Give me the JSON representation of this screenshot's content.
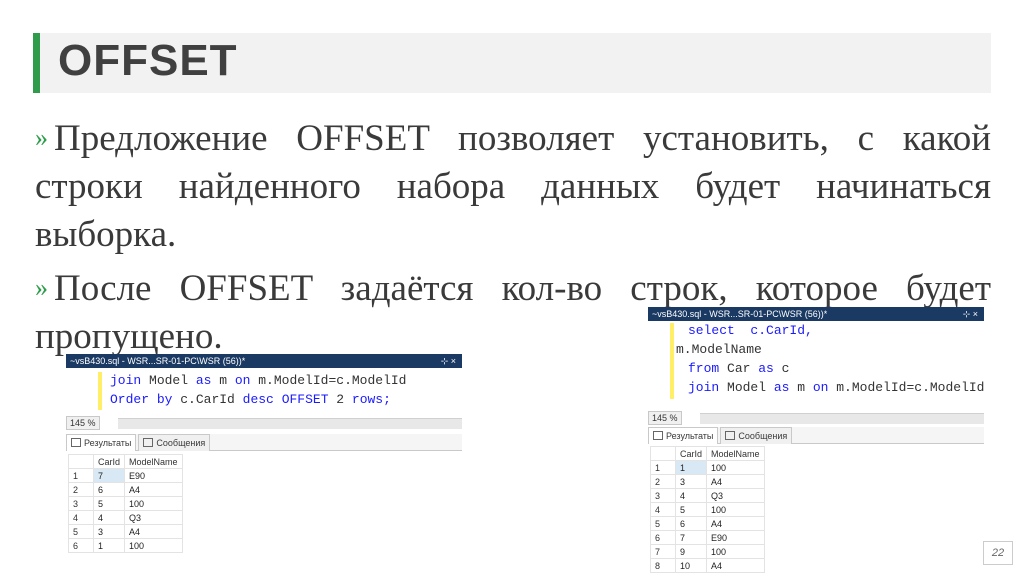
{
  "slide": {
    "title": "OFFSET",
    "bullet_marker": "»",
    "paragraphs": [
      "Предложение OFFSET позволяет установить, с какой строки найденного набора данных будет начинаться выборка.",
      "После OFFSET задаётся кол-во строк, которое будет пропущено."
    ],
    "page_number": "22"
  },
  "left_window": {
    "tab_title": "~vsB430.sql - WSR...SR-01-PC\\WSR (56))*",
    "pin": "⊹ ×",
    "code_lines": [
      "join Model as m on m.ModelId=c.ModelId",
      "Order by c.CarId desc OFFSET 2 rows;"
    ],
    "zoom": "145 %",
    "tabs": [
      "Результаты",
      "Сообщения"
    ],
    "columns": [
      "CarId",
      "ModelName"
    ],
    "rows": [
      [
        "1",
        "7",
        "E90"
      ],
      [
        "2",
        "6",
        "A4"
      ],
      [
        "3",
        "5",
        "100"
      ],
      [
        "4",
        "4",
        "Q3"
      ],
      [
        "5",
        "3",
        "A4"
      ],
      [
        "6",
        "1",
        "100"
      ]
    ]
  },
  "right_window": {
    "tab_title": "~vsB430.sql - WSR...SR-01-PC\\WSR (56))*",
    "pin": "⊹ ×",
    "code_lines": [
      "select  c.CarId,",
      "m.ModelName",
      "from Car as c",
      "join Model as m on m.ModelId=c.ModelId"
    ],
    "zoom": "145 %",
    "tabs": [
      "Результаты",
      "Сообщения"
    ],
    "columns": [
      "CarId",
      "ModelName"
    ],
    "rows": [
      [
        "1",
        "1",
        "100"
      ],
      [
        "2",
        "3",
        "A4"
      ],
      [
        "3",
        "4",
        "Q3"
      ],
      [
        "4",
        "5",
        "100"
      ],
      [
        "5",
        "6",
        "A4"
      ],
      [
        "6",
        "7",
        "E90"
      ],
      [
        "7",
        "9",
        "100"
      ],
      [
        "8",
        "10",
        "A4"
      ]
    ]
  },
  "colors": {
    "accent": "#2e9c4a",
    "tab_bg": "#1b3a63",
    "keyword": "#1a1aff"
  }
}
